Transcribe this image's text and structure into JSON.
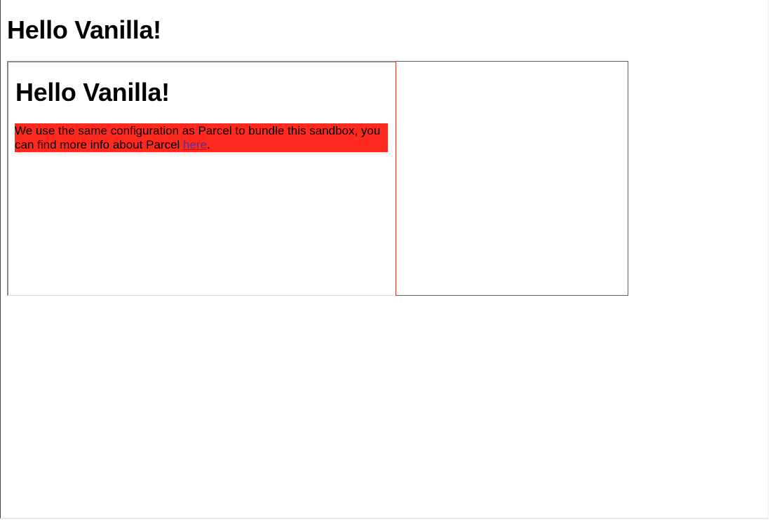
{
  "page": {
    "title": "Hello Vanilla!"
  },
  "preview": {
    "title": "Hello Vanilla!",
    "text_before_link": "We use the same configuration as Parcel to bundle this sandbox, you can find more info about Parcel ",
    "link_text": "here",
    "text_after_link": "."
  },
  "colors": {
    "paragraph_background": "#ff2a1f",
    "link": "#5a2d91",
    "outline_box": "#d9302a"
  }
}
